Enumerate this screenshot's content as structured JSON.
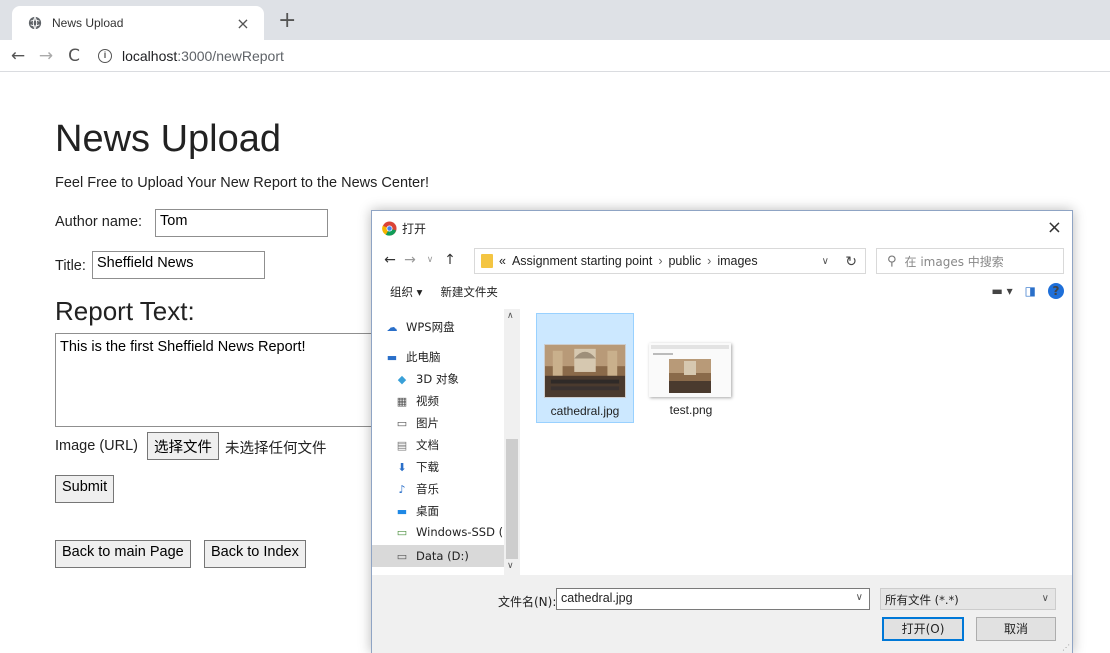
{
  "browser": {
    "tab_title": "News Upload",
    "tab_close": "×",
    "new_tab": "+",
    "url_host": "localhost",
    "url_path": ":3000/newReport"
  },
  "page": {
    "heading": "News Upload",
    "lead": "Feel Free to Upload Your New Report to the News Center!",
    "author_label": "Author name:",
    "author_value": "Tom",
    "title_label": "Title:",
    "title_value": "Sheffield News",
    "report_heading": "Report Text:",
    "report_text": "This is the first Sheffield News Report!",
    "image_label": "Image (URL)",
    "choose_file": "选择文件",
    "no_file": "未选择任何文件",
    "submit": "Submit",
    "back_main": "Back to main Page",
    "back_index": "Back to Index"
  },
  "dialog": {
    "title": "打开",
    "close": "×",
    "breadcrumb": [
      "«",
      "Assignment starting point",
      "public",
      "images"
    ],
    "search_placeholder": "在 images 中搜索",
    "toolbar": {
      "organize": "组织 ▾",
      "new_folder": "新建文件夹"
    },
    "tree": [
      {
        "label": "WPS网盘",
        "icon": "cloud-icon"
      },
      {
        "label": "此电脑",
        "icon": "computer-icon"
      },
      {
        "label": "3D 对象",
        "icon": "3d-objects-icon"
      },
      {
        "label": "视频",
        "icon": "video-icon"
      },
      {
        "label": "图片",
        "icon": "pictures-icon"
      },
      {
        "label": "文档",
        "icon": "documents-icon"
      },
      {
        "label": "下载",
        "icon": "download-icon"
      },
      {
        "label": "音乐",
        "icon": "music-icon"
      },
      {
        "label": "桌面",
        "icon": "desktop-icon"
      },
      {
        "label": "Windows-SSD (",
        "icon": "drive-icon"
      },
      {
        "label": "Data (D:)",
        "icon": "drive-icon"
      }
    ],
    "files": [
      {
        "name": "cathedral.jpg",
        "selected": true
      },
      {
        "name": "test.png",
        "selected": false
      }
    ],
    "filename_label": "文件名(N):",
    "filename_value": "cathedral.jpg",
    "filetype": "所有文件 (*.*)",
    "open_button": "打开(O)",
    "cancel_button": "取消"
  }
}
